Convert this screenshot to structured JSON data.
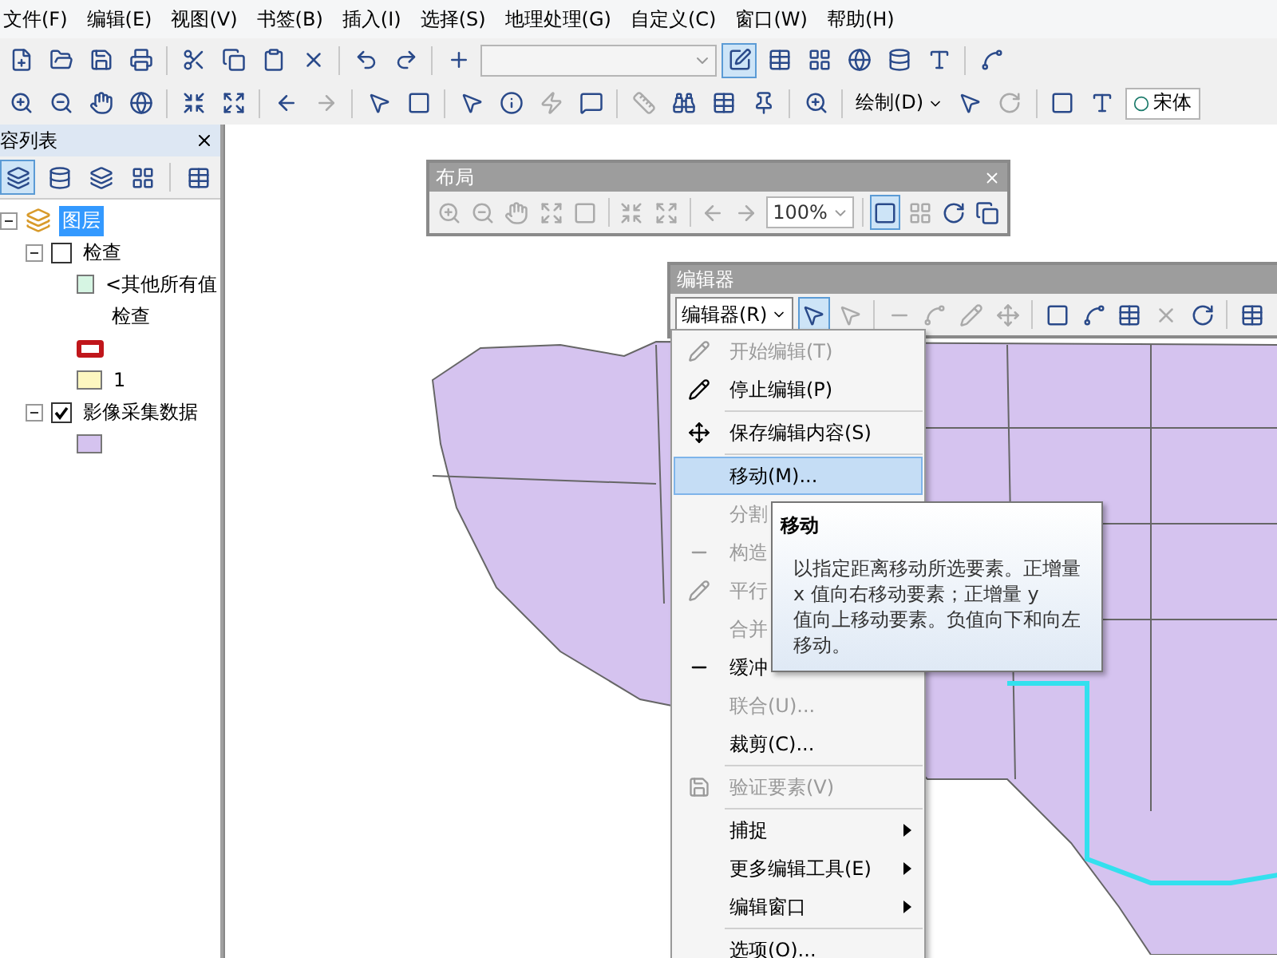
{
  "menu_bar": [
    "文件(F)",
    "编辑(E)",
    "视图(V)",
    "书签(B)",
    "插入(I)",
    "选择(S)",
    "地理处理(G)",
    "自定义(C)",
    "窗口(W)",
    "帮助(H)"
  ],
  "draw_toolbar": {
    "draw_menu": "绘制(D)",
    "font": "宋体"
  },
  "toc": {
    "title": "容列表",
    "items": [
      {
        "label": "图层",
        "selected": true,
        "expanded": true,
        "children": [
          {
            "label": "检查",
            "checked": false,
            "expanded": true,
            "legend": [
              {
                "kind": "swatch",
                "color": "#d6f5e3",
                "label": "<其他所有值"
              },
              {
                "kind": "heading",
                "label": "检查"
              },
              {
                "kind": "outline",
                "color": "#c0161b"
              },
              {
                "kind": "swatch",
                "color": "#fdf7c0",
                "label": "1"
              }
            ]
          },
          {
            "label": "影像采集数据",
            "checked": true,
            "expanded": true,
            "legend": [
              {
                "kind": "swatch",
                "color": "#d5c3ef"
              }
            ]
          }
        ]
      }
    ]
  },
  "layout_toolbar": {
    "title": "布局",
    "zoom": "100%"
  },
  "editor_toolbar": {
    "title": "编辑器",
    "dropdown": "编辑器(R)"
  },
  "editor_menu": [
    {
      "kind": "item",
      "label": "开始编辑(T)",
      "disabled": true,
      "icon": true
    },
    {
      "kind": "item",
      "label": "停止编辑(P)",
      "disabled": false,
      "icon": true
    },
    {
      "kind": "separator"
    },
    {
      "kind": "item",
      "label": "保存编辑内容(S)",
      "disabled": false,
      "icon": true
    },
    {
      "kind": "separator"
    },
    {
      "kind": "item",
      "label": "移动(M)...",
      "disabled": false,
      "selected": true
    },
    {
      "kind": "item",
      "label": "分割",
      "disabled": true
    },
    {
      "kind": "item",
      "label": "构造",
      "disabled": true,
      "icon": true
    },
    {
      "kind": "item",
      "label": "平行",
      "disabled": true,
      "icon": true
    },
    {
      "kind": "item",
      "label": "合并",
      "disabled": true
    },
    {
      "kind": "item",
      "label": "缓冲",
      "disabled": false,
      "icon": true
    },
    {
      "kind": "item",
      "label": "联合(U)...",
      "disabled": true
    },
    {
      "kind": "item",
      "label": "裁剪(C)...",
      "disabled": false
    },
    {
      "kind": "separator"
    },
    {
      "kind": "item",
      "label": "验证要素(V)",
      "disabled": true,
      "icon": true
    },
    {
      "kind": "separator"
    },
    {
      "kind": "submenu",
      "label": "捕捉"
    },
    {
      "kind": "submenu",
      "label": "更多编辑工具(E)"
    },
    {
      "kind": "submenu",
      "label": "编辑窗口"
    },
    {
      "kind": "separator"
    },
    {
      "kind": "item",
      "label": "选项(O)...",
      "disabled": false
    }
  ],
  "tooltip": {
    "title": "移动",
    "body_lines": [
      "以指定距离移动所选要素。正增量",
      "x 值向右移动要素；正增量 y",
      "值向上移动要素。负值向下和向左",
      "移动。"
    ]
  }
}
